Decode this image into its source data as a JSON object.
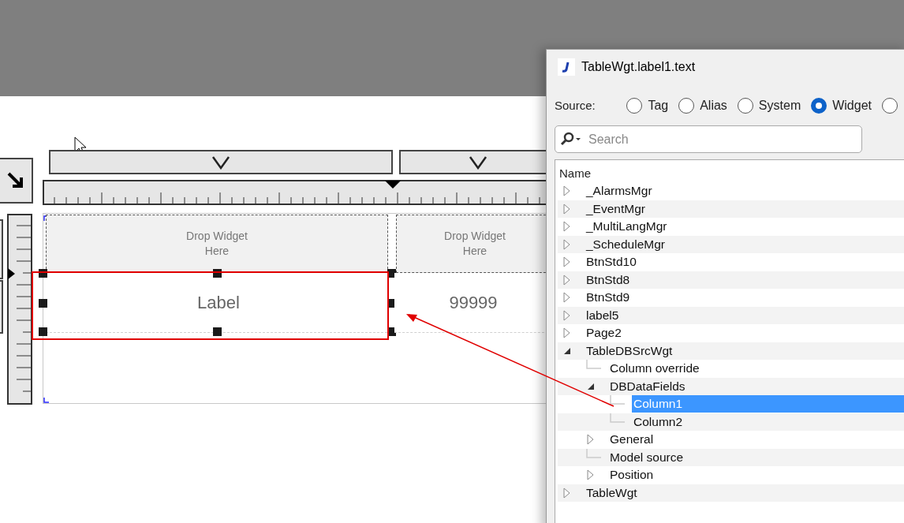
{
  "designer": {
    "column_headers": [
      {
        "kind": "chevron"
      },
      {
        "kind": "chevron"
      }
    ],
    "drop_zones": [
      {
        "text": "Drop Widget\nHere"
      },
      {
        "text": "Drop Widget\nHere"
      }
    ],
    "cells": [
      {
        "text": "Label",
        "selected": true
      },
      {
        "text": "99999",
        "selected": false
      }
    ]
  },
  "dialog": {
    "title": "TableWgt.label1.text",
    "source": {
      "label": "Source:",
      "options": [
        {
          "label": "Tag",
          "selected": false
        },
        {
          "label": "Alias",
          "selected": false
        },
        {
          "label": "System",
          "selected": false
        },
        {
          "label": "Widget",
          "selected": true
        },
        {
          "selected": false
        }
      ]
    },
    "search": {
      "placeholder": "Search"
    },
    "tree": {
      "header": "Name",
      "items": [
        {
          "label": "_AlarmsMgr",
          "expanded": false,
          "selected": false
        },
        {
          "label": "_EventMgr",
          "expanded": false,
          "selected": false
        },
        {
          "label": "_MultiLangMgr",
          "expanded": false,
          "selected": false
        },
        {
          "label": "_ScheduleMgr",
          "expanded": false,
          "selected": false
        },
        {
          "label": "BtnStd10",
          "expanded": false,
          "selected": false
        },
        {
          "label": "BtnStd8",
          "expanded": false,
          "selected": false
        },
        {
          "label": "BtnStd9",
          "expanded": false,
          "selected": false
        },
        {
          "label": "label5",
          "expanded": false,
          "selected": false
        },
        {
          "label": "Page2",
          "expanded": false,
          "selected": false
        },
        {
          "label": "TableDBSrcWgt",
          "expanded": true,
          "selected": false,
          "children": [
            {
              "label": "Column override",
              "selected": false
            },
            {
              "label": "DBDataFields",
              "expanded": true,
              "selected": false,
              "children": [
                {
                  "label": "Column1",
                  "selected": true
                },
                {
                  "label": "Column2",
                  "selected": false
                }
              ]
            },
            {
              "label": "General",
              "expanded": false,
              "selected": false
            },
            {
              "label": "Model source",
              "selected": false
            },
            {
              "label": "Position",
              "expanded": false,
              "selected": false
            }
          ]
        },
        {
          "label": "TableWgt",
          "expanded": false,
          "selected": false
        }
      ]
    }
  }
}
